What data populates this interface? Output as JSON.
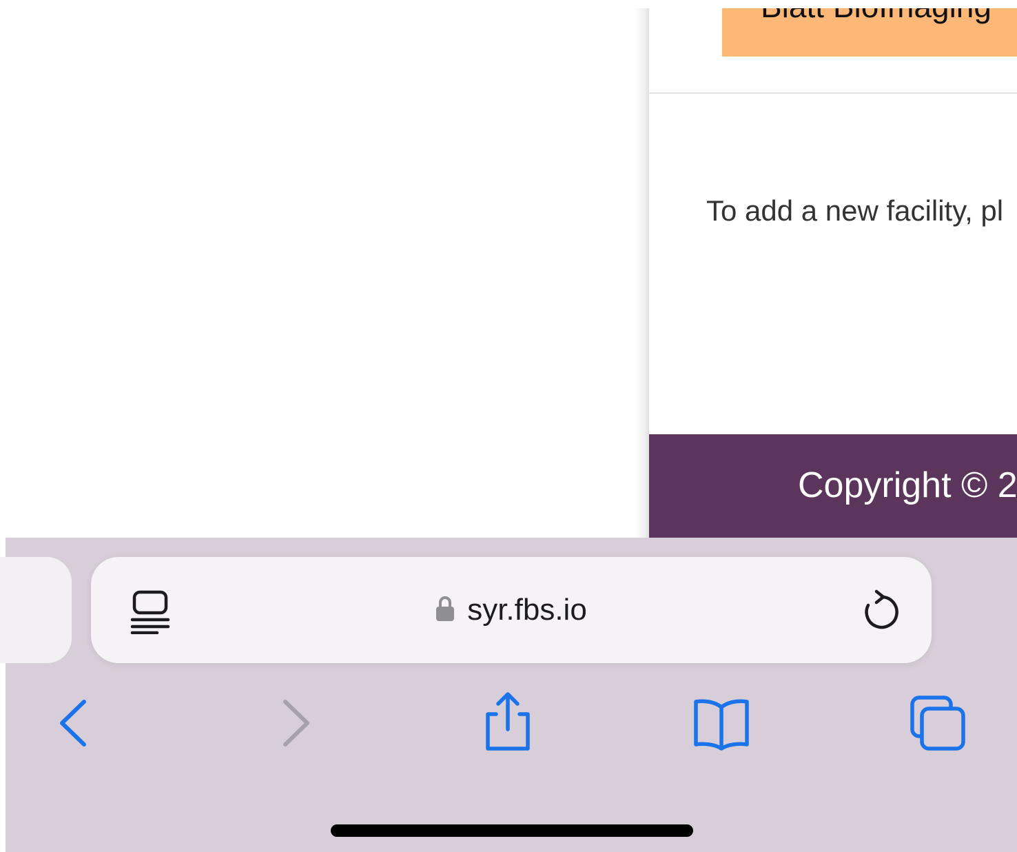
{
  "webpage": {
    "banner_text": "Blatt BioImaging",
    "info_text": "To add a new facility, pl",
    "footer_copyright": "Copyright © 2"
  },
  "browser": {
    "url": "syr.fbs.io",
    "colors": {
      "accent": "#1a73e8",
      "toolbar_bg": "#d8ced9",
      "footer_bg": "#5c355c",
      "banner_bg": "#fdb877"
    },
    "icons": {
      "reader": "reader-mode-icon",
      "lock": "lock-icon",
      "reload": "reload-icon",
      "back": "chevron-left-icon",
      "forward": "chevron-right-icon",
      "share": "share-icon",
      "bookmarks": "book-icon",
      "tabs": "tabs-icon"
    }
  }
}
